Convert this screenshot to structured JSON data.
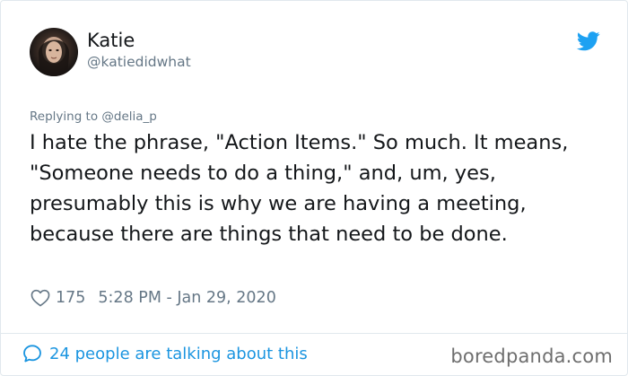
{
  "author": {
    "name": "Katie",
    "handle": "@katiedidwhat"
  },
  "reply": {
    "prefix": "Replying to",
    "mention": "@delia_p"
  },
  "tweet": {
    "text": "I hate the phrase, \"Action Items.\" So much. It means, \"Someone needs to do a thing,\" and, um, yes, presumably this is why we are having a meeting, because there are things that need to be done."
  },
  "meta": {
    "likes": "175",
    "timestamp": "5:28 PM - Jan 29, 2020"
  },
  "footer": {
    "talking": "24 people are talking about this"
  },
  "watermark": "boredpanda.com",
  "icons": {
    "brand": "twitter-bird-icon",
    "like": "heart-icon",
    "conversation": "speech-bubble-icon"
  },
  "colors": {
    "twitter_blue": "#1da1f2",
    "link_blue": "#1b95e0",
    "secondary_text": "#657786",
    "border": "#e1e8ed"
  }
}
